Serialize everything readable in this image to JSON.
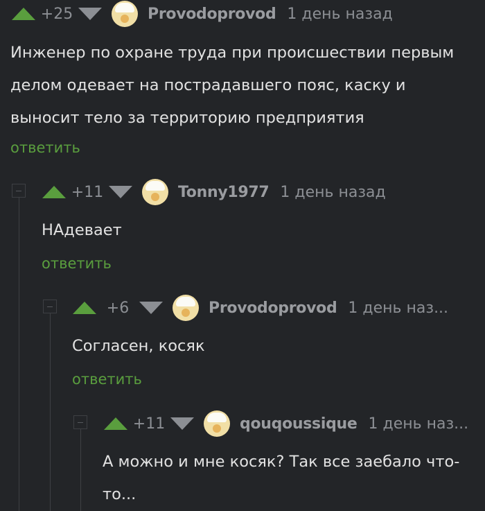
{
  "comments": [
    {
      "score": "+25",
      "username": "Provodoprovod",
      "time": "1 день назад",
      "lines": [
        "Инженер по охране труда при происшествии первым",
        "делом одевает на пострадавшего пояс, каску и",
        "выносит тело за территорию предприятия"
      ],
      "reply_label": "ответить"
    },
    {
      "score": "+11",
      "username": "Tonny1977",
      "time": "1 день назад",
      "lines": [
        "НАдевает"
      ],
      "reply_label": "ответить"
    },
    {
      "score": "+6",
      "username": "Provodoprovod",
      "time": "1 день наз...",
      "lines": [
        "Согласен, косяк"
      ],
      "reply_label": "ответить"
    },
    {
      "score": "+11",
      "username": "qouqoussique",
      "time": "1 день наз...",
      "lines": [
        "А можно и мне косяк? Так все заебало что-",
        "то..."
      ]
    }
  ],
  "colors": {
    "upvote": "#5a9e3e",
    "reply_link": "#5a9e3e",
    "background": "#232528"
  }
}
